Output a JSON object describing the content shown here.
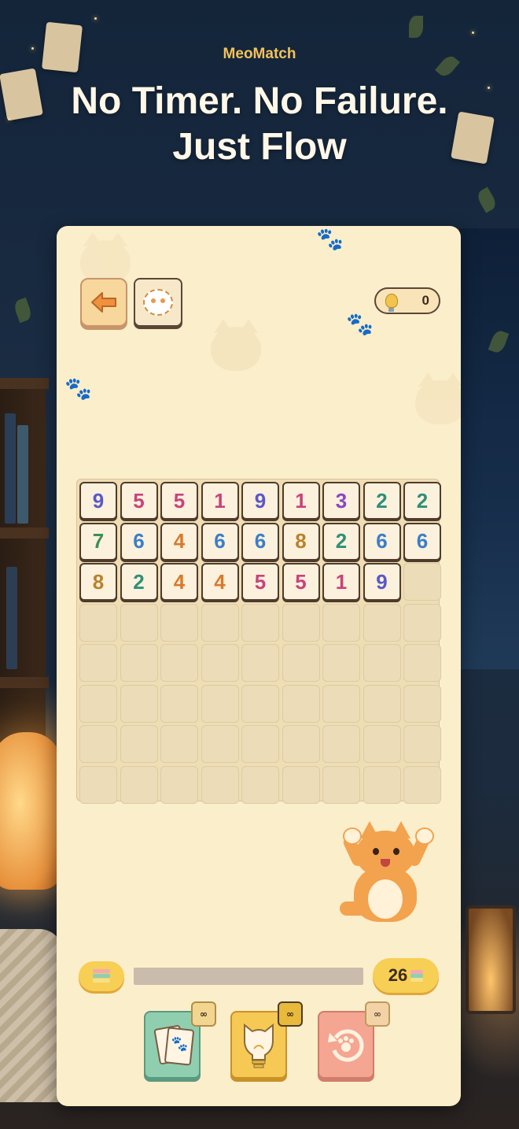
{
  "app": {
    "brand": "MeoMatch",
    "headline": "No Timer. No Failure. Just Flow"
  },
  "topbar": {
    "hint_count": "0"
  },
  "board": {
    "columns": 9,
    "rows": 8,
    "tiles": [
      {
        "v": "9",
        "c": "#5a58c8"
      },
      {
        "v": "5",
        "c": "#c8437d"
      },
      {
        "v": "5",
        "c": "#c8437d"
      },
      {
        "v": "1",
        "c": "#c8437d"
      },
      {
        "v": "9",
        "c": "#5a58c8"
      },
      {
        "v": "1",
        "c": "#c8437d"
      },
      {
        "v": "3",
        "c": "#8a46c2"
      },
      {
        "v": "2",
        "c": "#2f8f7a"
      },
      {
        "v": "2",
        "c": "#2f8f7a"
      },
      {
        "v": "7",
        "c": "#3f8f55"
      },
      {
        "v": "6",
        "c": "#3b7ec8"
      },
      {
        "v": "4",
        "c": "#d87a2c"
      },
      {
        "v": "6",
        "c": "#3b7ec8"
      },
      {
        "v": "6",
        "c": "#3b7ec8"
      },
      {
        "v": "8",
        "c": "#b9812c"
      },
      {
        "v": "2",
        "c": "#2f8f7a"
      },
      {
        "v": "6",
        "c": "#3b7ec8"
      },
      {
        "v": "6",
        "c": "#3b7ec8"
      },
      {
        "v": "8",
        "c": "#b9812c"
      },
      {
        "v": "2",
        "c": "#2f8f7a"
      },
      {
        "v": "4",
        "c": "#d87a2c"
      },
      {
        "v": "4",
        "c": "#d87a2c"
      },
      {
        "v": "5",
        "c": "#c8437d"
      },
      {
        "v": "5",
        "c": "#c8437d"
      },
      {
        "v": "1",
        "c": "#c8437d"
      },
      {
        "v": "9",
        "c": "#5a58c8"
      }
    ]
  },
  "progress": {
    "fraction": 0.0,
    "coins": "26"
  },
  "tools": {
    "cards_badge": "∞",
    "hint_badge": "∞",
    "undo_badge": "∞"
  },
  "icons": [
    "back-arrow-icon",
    "cat-avatar-icon",
    "lightbulb-icon",
    "cake-stack-icon",
    "cards-icon",
    "cat-bulb-icon",
    "undo-paw-icon"
  ]
}
